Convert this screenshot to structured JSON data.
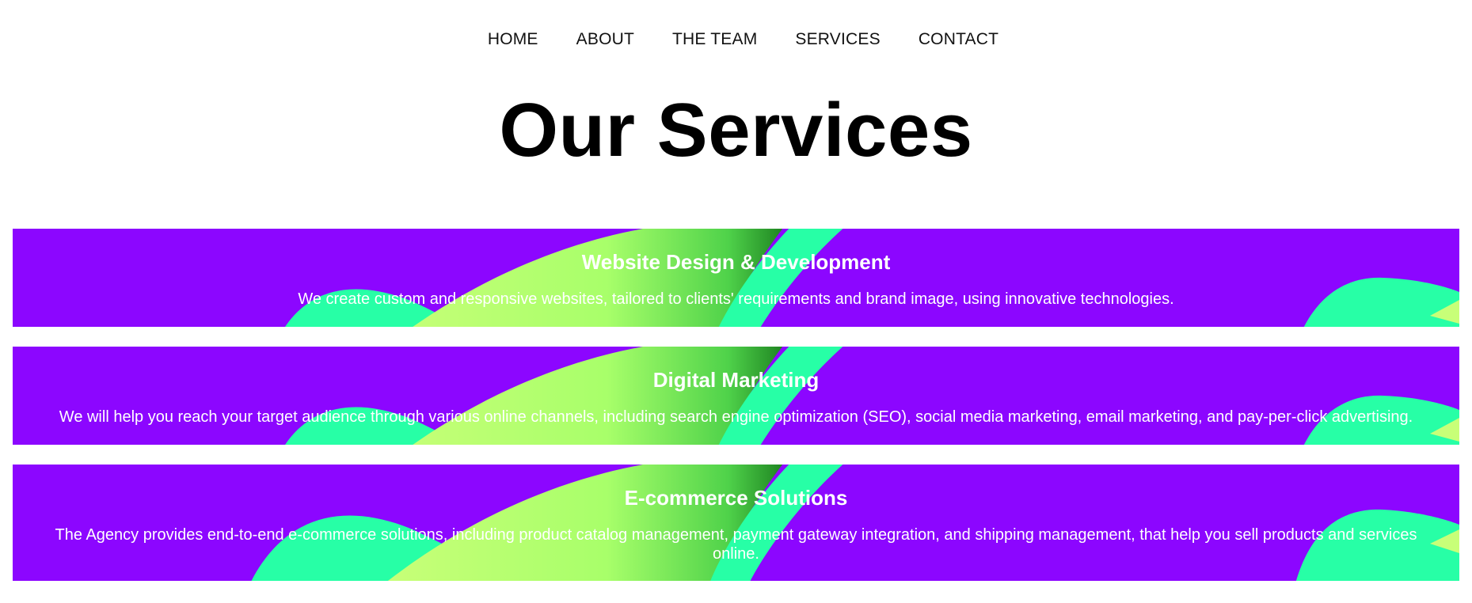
{
  "nav": {
    "items": [
      {
        "label": "HOME"
      },
      {
        "label": "ABOUT"
      },
      {
        "label": "THE TEAM"
      },
      {
        "label": "SERVICES"
      },
      {
        "label": "CONTACT"
      }
    ]
  },
  "main": {
    "title": "Our Services",
    "services": [
      {
        "title": "Website Design & Development",
        "description": "We create custom and responsive websites, tailored to clients' requirements and brand image, using innovative technologies."
      },
      {
        "title": "Digital Marketing",
        "description": "We will help you reach your target audience through various online channels, including search engine optimization (SEO), social media marketing, email marketing, and pay-per-click advertising."
      },
      {
        "title": "E-commerce Solutions",
        "description": "The Agency provides end-to-end e-commerce solutions, including product catalog management, payment gateway integration, and shipping management, that help you sell products and services online."
      }
    ]
  },
  "colors": {
    "card_background": "#8c06ff",
    "wave_teal": "#27ffa6",
    "wave_lime": "#b6ff6e",
    "wave_green": "#1f8a1c",
    "text_on_card": "#ffffff"
  }
}
